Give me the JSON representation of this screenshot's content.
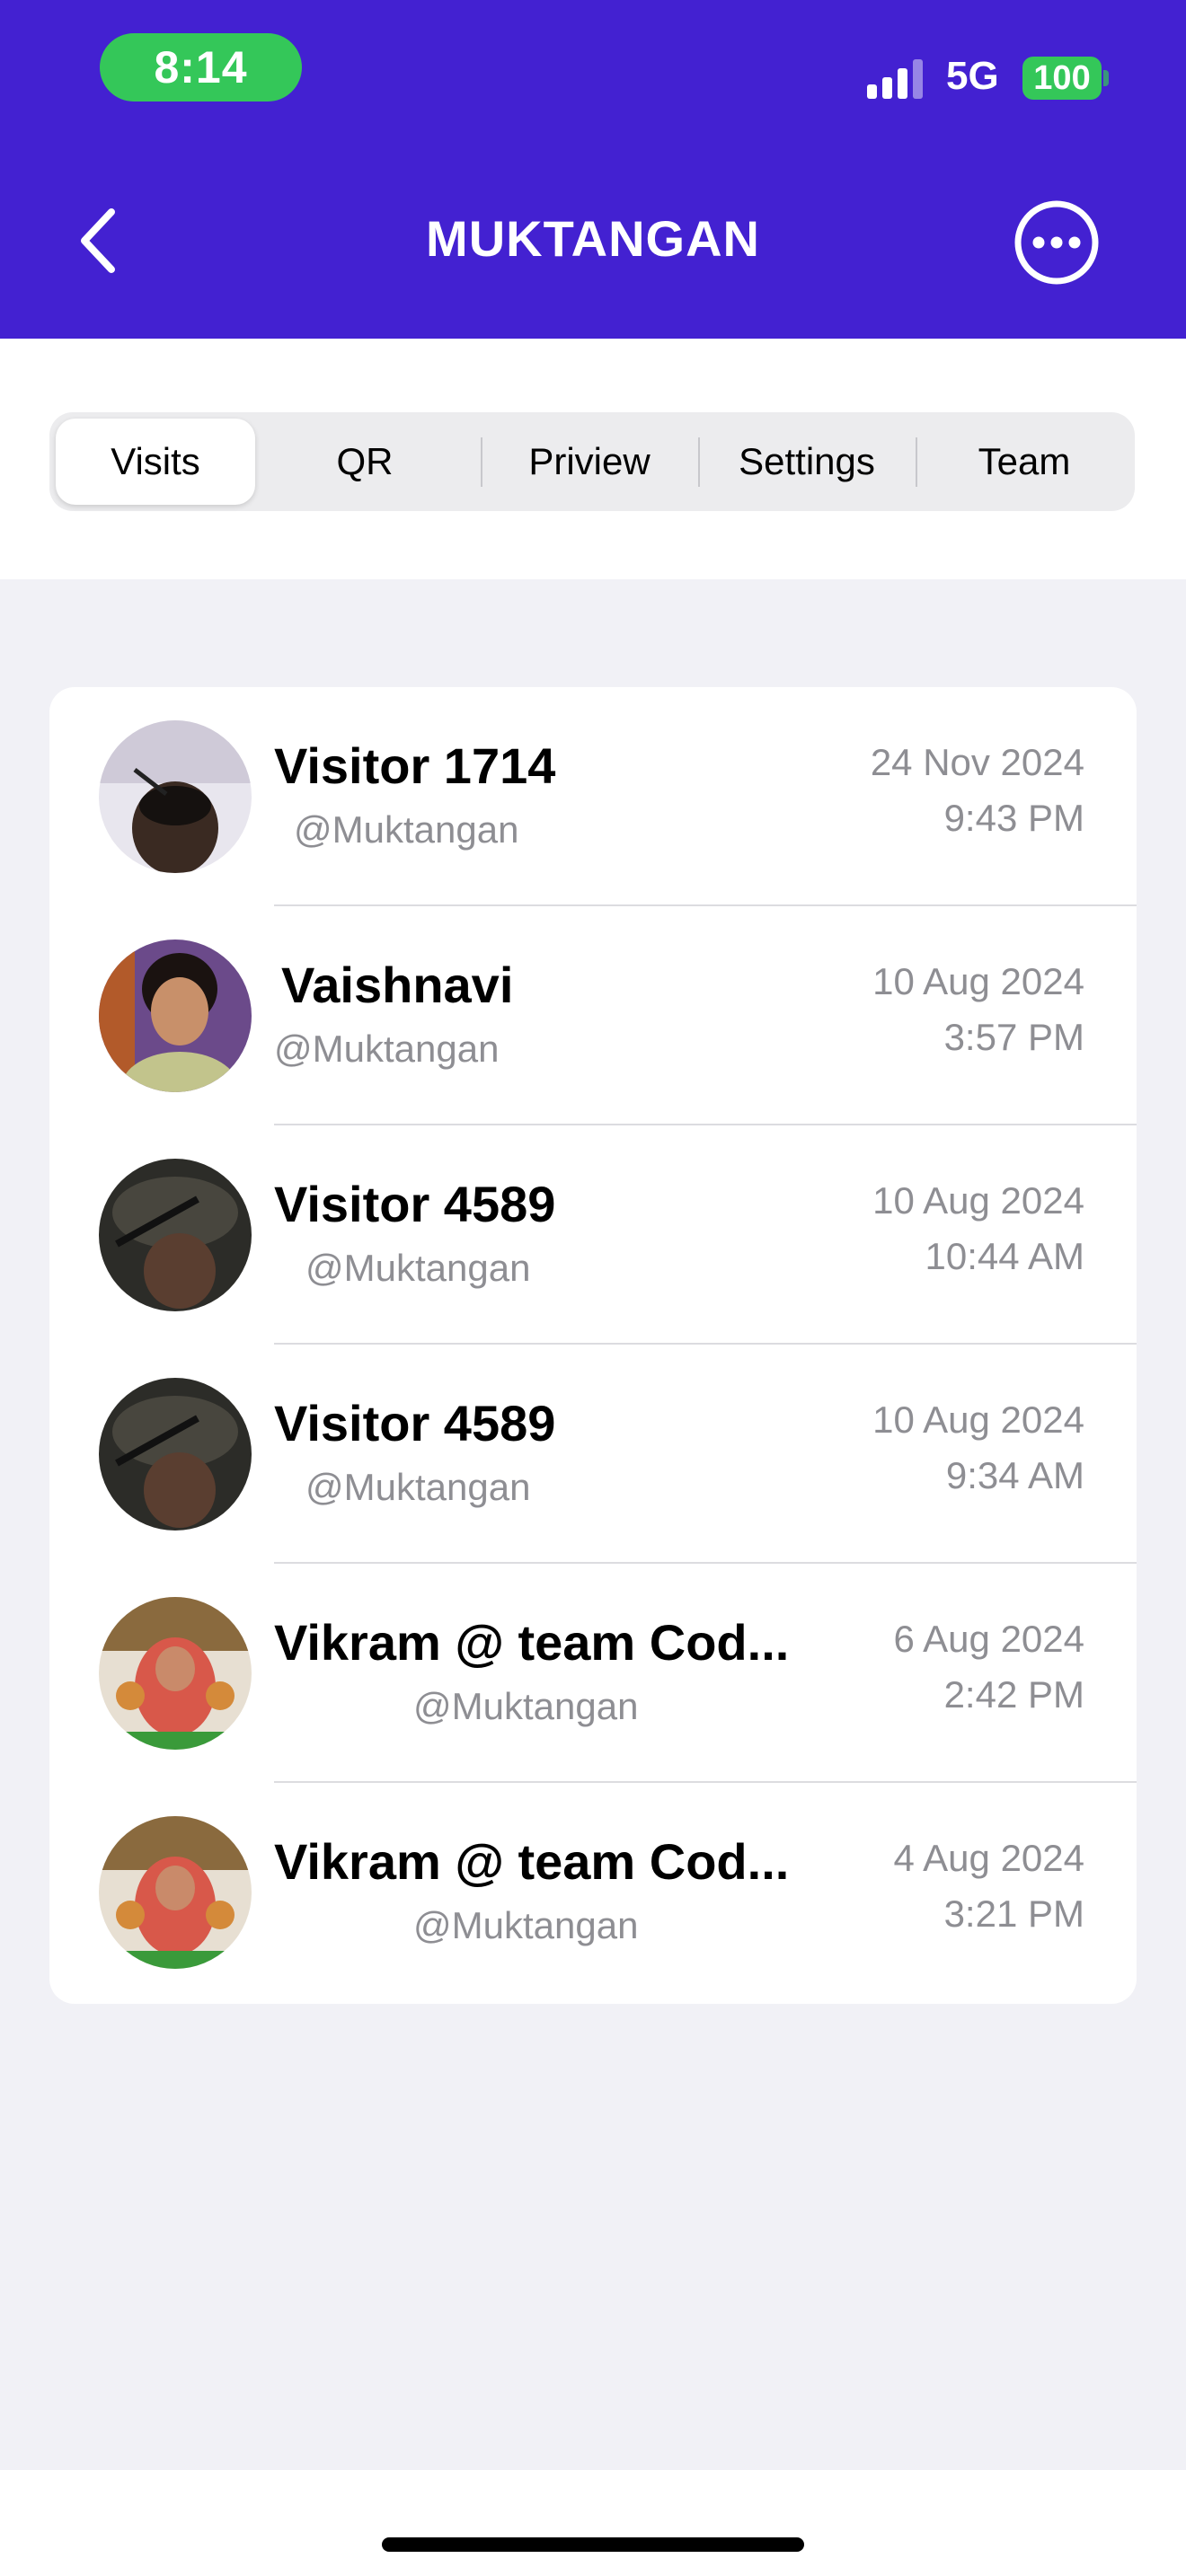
{
  "status_bar": {
    "time": "8:14",
    "network": "5G",
    "battery": "100"
  },
  "header": {
    "title": "MUKTANGAN",
    "back_icon": "chevron-left-icon",
    "more_icon": "ellipsis-circle-icon"
  },
  "tabs": [
    {
      "label": "Visits",
      "active": true
    },
    {
      "label": "QR",
      "active": false
    },
    {
      "label": "Priview",
      "active": false
    },
    {
      "label": "Settings",
      "active": false
    },
    {
      "label": "Team",
      "active": false
    }
  ],
  "visits": [
    {
      "name": "Visitor 1714",
      "handle": "@Muktangan",
      "date": "24 Nov 2024",
      "time": "9:43 PM"
    },
    {
      "name": "Vaishnavi",
      "handle": "@Muktangan",
      "date": "10 Aug 2024",
      "time": "3:57 PM"
    },
    {
      "name": "Visitor 4589",
      "handle": "@Muktangan",
      "date": "10 Aug 2024",
      "time": "10:44 AM"
    },
    {
      "name": "Visitor 4589",
      "handle": "@Muktangan",
      "date": "10 Aug 2024",
      "time": "9:34 AM"
    },
    {
      "name": "Vikram @ team Cod...",
      "handle": "@Muktangan",
      "date": "6 Aug 2024",
      "time": "2:42 PM"
    },
    {
      "name": "Vikram @ team Cod...",
      "handle": "@Muktangan",
      "date": "4 Aug 2024",
      "time": "3:21 PM"
    }
  ],
  "colors": {
    "header_bg": "#4321d1",
    "accent_green": "#34c759",
    "secondary_text": "#8e8e93",
    "page_bg": "#f1f1f6"
  }
}
